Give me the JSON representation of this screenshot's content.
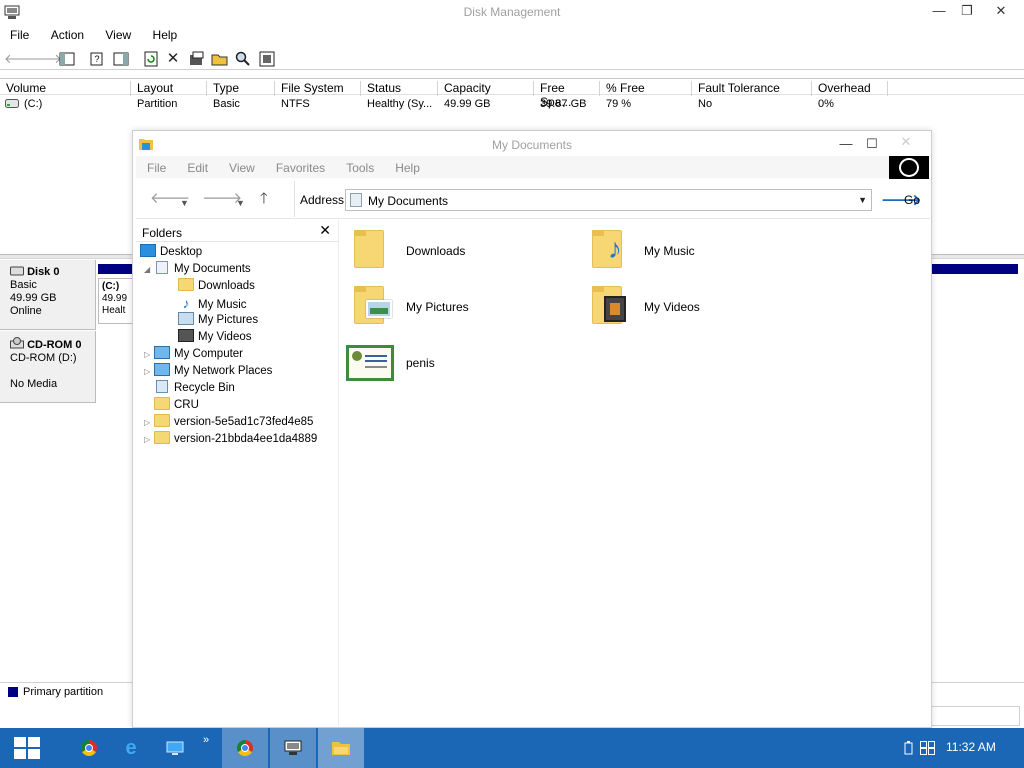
{
  "disk_mgmt": {
    "title": "Disk Management",
    "menu": [
      "File",
      "Action",
      "View",
      "Help"
    ],
    "controls": {
      "minimize": "—",
      "maximize": "❐",
      "close": "✕"
    },
    "columns": [
      "Volume",
      "Layout",
      "Type",
      "File System",
      "Status",
      "Capacity",
      "Free Spa...",
      "% Free",
      "Fault Tolerance",
      "Overhead"
    ],
    "volume_row": {
      "volume": "(C:)",
      "layout": "Partition",
      "type": "Basic",
      "file_system": "NTFS",
      "status": "Healthy (Sy...",
      "capacity": "49.99 GB",
      "free_space": "39.87 GB",
      "percent_free": "79 %",
      "fault_tolerance": "No",
      "overhead": "0%"
    },
    "disk0": {
      "name": "Disk 0",
      "type": "Basic",
      "size": "49.99 GB",
      "state": "Online",
      "partition_name": "(C:)",
      "partition_size": "49.99",
      "partition_status": "Healt"
    },
    "cdrom0": {
      "name": "CD-ROM 0",
      "type": "CD-ROM (D:)",
      "media": "No Media"
    },
    "legend": "Primary partition",
    "legend_color": "#000080"
  },
  "explorer": {
    "title": "My Documents",
    "menu": [
      "File",
      "Edit",
      "View",
      "Favorites",
      "Tools",
      "Help"
    ],
    "controls": {
      "minimize": "—",
      "maximize": "☐",
      "close": "✕"
    },
    "address_label": "Address",
    "address_value": "My Documents",
    "go_label": "Go",
    "folders_header": "Folders",
    "tree": [
      {
        "label": "Desktop",
        "icon": "desktop-icon"
      },
      {
        "label": "My Documents",
        "icon": "documents-icon"
      },
      {
        "label": "Downloads",
        "icon": "folder-icon"
      },
      {
        "label": "My Music",
        "icon": "music-note-icon"
      },
      {
        "label": "My Pictures",
        "icon": "pictures-icon"
      },
      {
        "label": "My Videos",
        "icon": "videos-icon"
      },
      {
        "label": "My Computer",
        "icon": "computer-icon"
      },
      {
        "label": "My Network Places",
        "icon": "network-icon"
      },
      {
        "label": "Recycle Bin",
        "icon": "recycle-bin-icon"
      },
      {
        "label": "CRU",
        "icon": "folder-icon"
      },
      {
        "label": "version-5e5ad1c73fed4e85",
        "icon": "folder-icon"
      },
      {
        "label": "version-21bbda4ee1da4889",
        "icon": "folder-icon"
      }
    ],
    "items": [
      {
        "label": "Downloads",
        "icon": "folder-icon"
      },
      {
        "label": "My Music",
        "icon": "music-folder-icon"
      },
      {
        "label": "My Pictures",
        "icon": "pictures-folder-icon"
      },
      {
        "label": "My Videos",
        "icon": "videos-folder-icon"
      },
      {
        "label": "penis",
        "icon": "certificate-icon"
      }
    ]
  },
  "taskbar": {
    "clock": "11:32 AM",
    "accent": "#1b66b5"
  }
}
